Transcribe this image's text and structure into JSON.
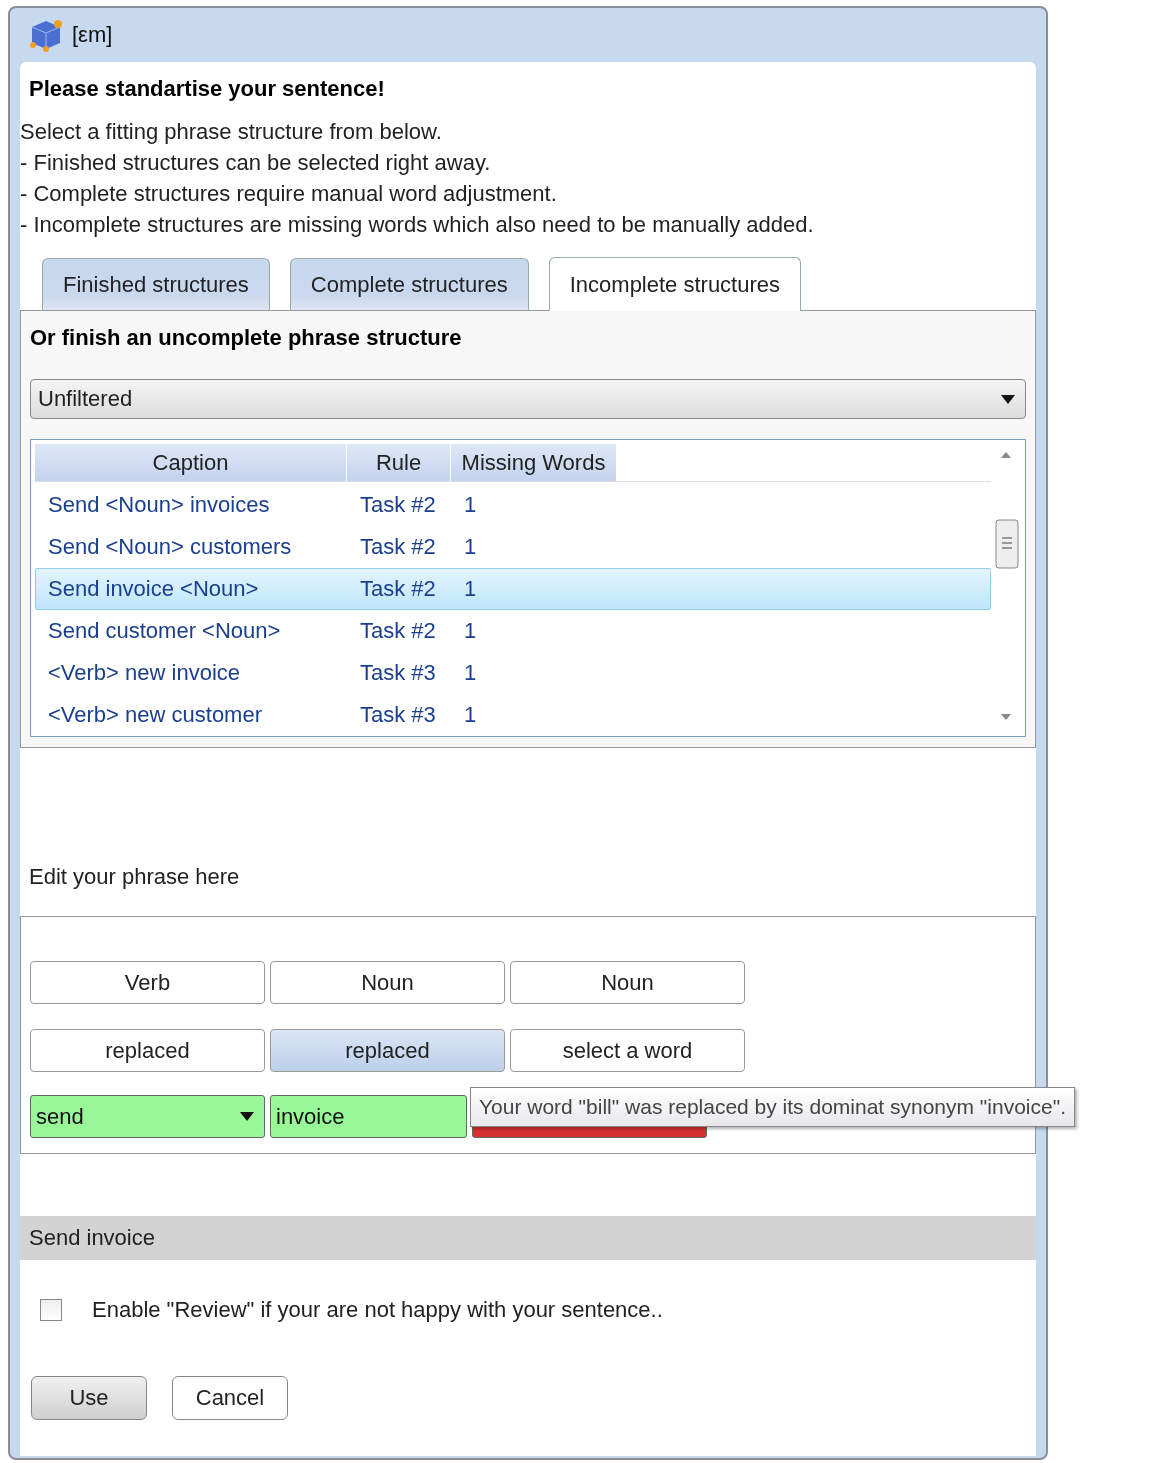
{
  "window": {
    "title": "[εm]"
  },
  "heading": "Please standartise your sentence!",
  "instructions": [
    "Select a fitting phrase structure from below.",
    "- Finished structures can be selected right away.",
    "- Complete structures require manual word adjustment.",
    "- Incomplete structures are missing words which also need to be manually added."
  ],
  "tabs": [
    {
      "label": "Finished structures",
      "selected": false
    },
    {
      "label": "Complete structures",
      "selected": false
    },
    {
      "label": "Incomplete structures",
      "selected": true
    }
  ],
  "panel": {
    "title": "Or finish an uncomplete phrase structure",
    "filter": "Unfiltered",
    "table": {
      "columns": [
        "Caption",
        "Rule",
        "Missing Words"
      ],
      "rows": [
        {
          "cells": [
            "Send <Noun> invoices",
            "Task #2",
            "1"
          ],
          "selected": false
        },
        {
          "cells": [
            "Send <Noun> customers",
            "Task #2",
            "1"
          ],
          "selected": false
        },
        {
          "cells": [
            "Send invoice <Noun>",
            "Task #2",
            "1"
          ],
          "selected": true
        },
        {
          "cells": [
            "Send customer <Noun>",
            "Task #2",
            "1"
          ],
          "selected": false
        },
        {
          "cells": [
            "<Verb> new invoice",
            "Task #3",
            "1"
          ],
          "selected": false
        },
        {
          "cells": [
            "<Verb> new customer",
            "Task #3",
            "1"
          ],
          "selected": false
        }
      ]
    }
  },
  "editor": {
    "label": "Edit your phrase here",
    "types": [
      "Verb",
      "Noun",
      "Noun"
    ],
    "actions": [
      {
        "label": "replaced",
        "selected": false
      },
      {
        "label": "replaced",
        "selected": true
      },
      {
        "label": "select a word",
        "selected": false
      }
    ],
    "words": [
      {
        "kind": "dropdown",
        "value": "send",
        "color": "#98f898"
      },
      {
        "kind": "field",
        "value": "invoice",
        "color": "#98f898"
      },
      {
        "kind": "field",
        "color": "#d83030"
      }
    ],
    "tooltip": "Your word \"bill\" was replaced by its dominat synonym \"invoice\"."
  },
  "status_bar": "Send invoice",
  "review": {
    "label": "Enable \"Review\" if your are not happy with your sentence..",
    "checked": false
  },
  "buttons": [
    {
      "label": "Use",
      "kind": "primary"
    },
    {
      "label": "Cancel",
      "kind": "secondary"
    }
  ]
}
